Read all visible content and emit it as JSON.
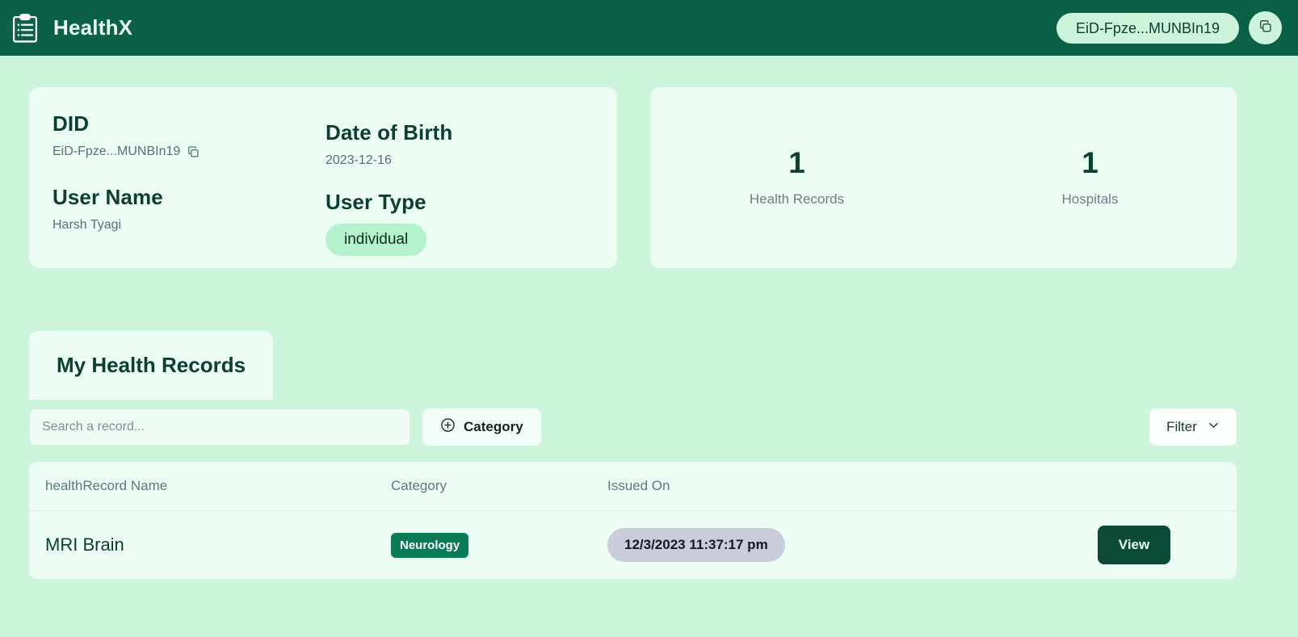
{
  "header": {
    "brand_title": "HealthX",
    "brand_icon": "clipboard-list-icon",
    "did_pill_label": "EiD-Fpze...MUNBIn19",
    "copy_icon": "copy-icon"
  },
  "profile_card": {
    "did_label": "DID",
    "did_value": "EiD-Fpze...MUNBIn19",
    "did_copy_icon": "copy-icon",
    "dob_label": "Date of Birth",
    "dob_value": "2023-12-16",
    "username_label": "User Name",
    "username_value": "Harsh Tyagi",
    "usertype_label": "User Type",
    "usertype_value": "individual"
  },
  "stats": [
    {
      "value": "1",
      "label": "Health Records"
    },
    {
      "value": "1",
      "label": "Hospitals"
    }
  ],
  "records": {
    "tab_label": "My Health Records",
    "search_placeholder": "Search a record...",
    "search_value": "",
    "category_button_label": "Category",
    "category_button_icon": "plus-circle-icon",
    "filter_button_label": "Filter",
    "filter_button_icon": "chevron-down-icon",
    "columns": [
      "healthRecord Name",
      "Category",
      "Issued On"
    ],
    "rows": [
      {
        "name": "MRI Brain",
        "category": "Neurology",
        "issued_on": "12/3/2023 11:37:17 pm",
        "action_label": "View"
      }
    ]
  },
  "colors": {
    "page_background": "#cdf5dc",
    "header_green": "#0a6148",
    "card_background": "#ecfdf3",
    "accent_dark_green": "#0a4a36",
    "badge_green": "#0a7a57",
    "badge_light_green": "#b3f2cd",
    "date_pill": "#c8ccdb"
  }
}
